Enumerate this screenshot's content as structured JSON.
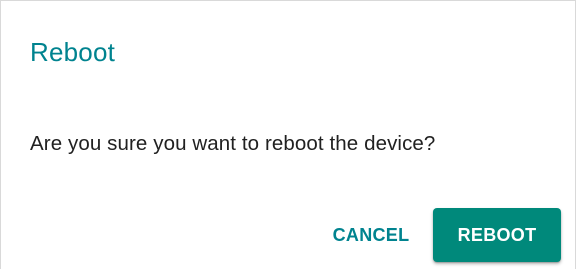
{
  "dialog": {
    "title": "Reboot",
    "message": "Are you sure you want to reboot the device?",
    "cancel_label": "CANCEL",
    "confirm_label": "REBOOT"
  },
  "colors": {
    "accent": "#00838f",
    "primary_button": "#00897b",
    "text": "#212121"
  }
}
